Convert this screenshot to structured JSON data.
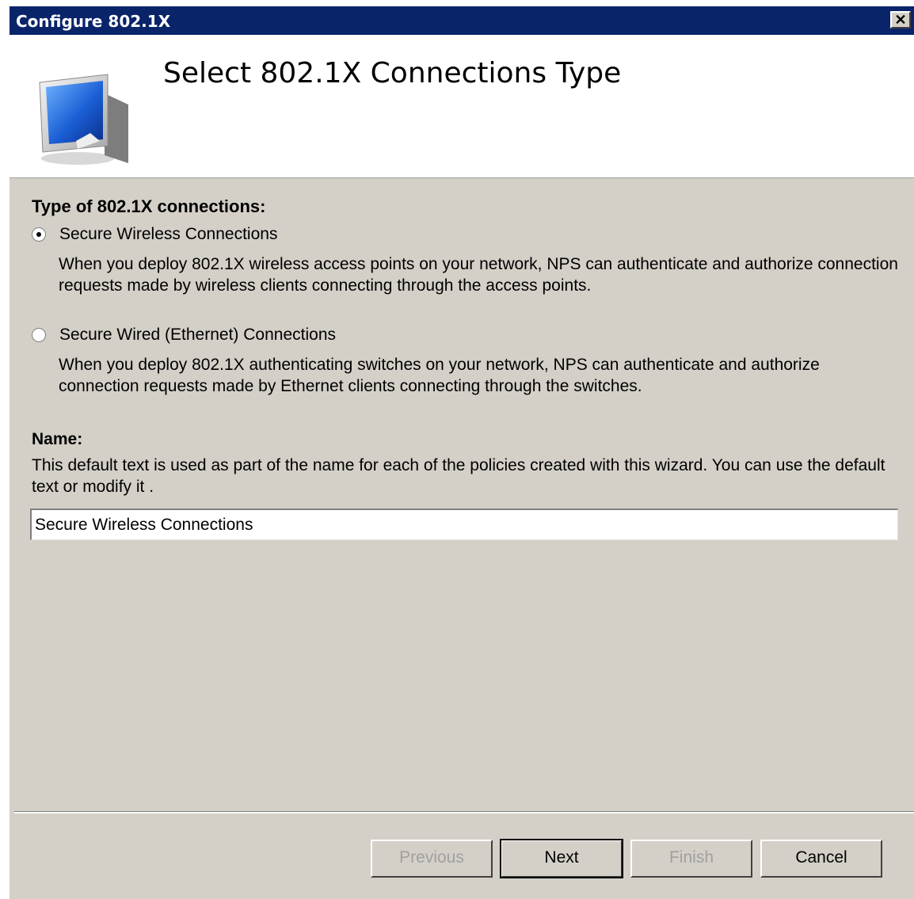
{
  "window": {
    "title": "Configure 802.1X",
    "close_glyph": "✕"
  },
  "header": {
    "title": "Select 802.1X Connections Type",
    "icon": "monitor-network-icon"
  },
  "connection_type": {
    "heading": "Type of 802.1X connections:",
    "options": [
      {
        "label": "Secure Wireless Connections",
        "checked": true,
        "description": "When you deploy 802.1X wireless access points on your network, NPS can authenticate and authorize connection requests made by wireless clients connecting through the access points."
      },
      {
        "label": "Secure Wired (Ethernet) Connections",
        "checked": false,
        "description": "When you deploy 802.1X authenticating switches on your network, NPS can authenticate and authorize connection requests made by Ethernet clients connecting through the switches."
      }
    ]
  },
  "name": {
    "heading": "Name:",
    "description": "This default text is used as part of the name for each of the policies created with this wizard. You can use the default text or modify it .",
    "value": "Secure Wireless Connections"
  },
  "buttons": {
    "previous": "Previous",
    "next": "Next",
    "finish": "Finish",
    "cancel": "Cancel"
  },
  "colors": {
    "titlebar": "#0a246a",
    "dialog_bg": "#d4d0c8",
    "header_bg": "#ffffff",
    "disabled_text": "#a0a0a0"
  }
}
